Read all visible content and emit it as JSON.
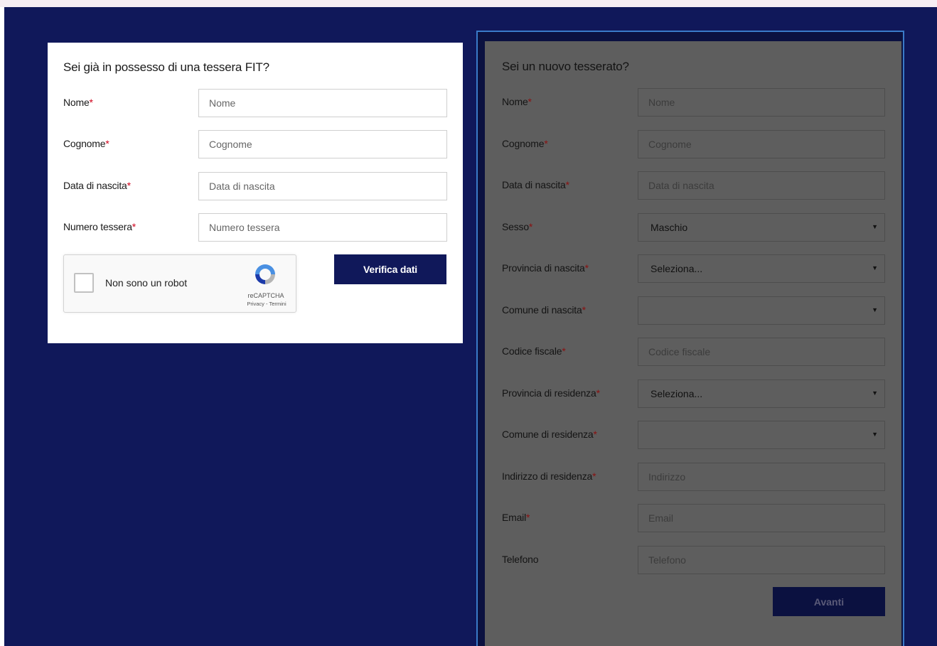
{
  "existing": {
    "title": "Sei già in possesso di una tessera FIT?",
    "required_mark": "*",
    "fields": [
      {
        "label": "Nome",
        "placeholder": "Nome"
      },
      {
        "label": "Cognome",
        "placeholder": "Cognome"
      },
      {
        "label": "Data di nascita",
        "placeholder": "Data di nascita"
      },
      {
        "label": "Numero tessera",
        "placeholder": "Numero tessera"
      }
    ],
    "captcha": {
      "text": "Non sono un robot",
      "brand": "reCAPTCHA",
      "links": "Privacy - Termini",
      "icon": "recaptcha-logo-icon"
    },
    "verify_button": "Verifica dati"
  },
  "new_member": {
    "title": "Sei un nuovo tesserato?",
    "fields": [
      {
        "label": "Nome",
        "required": "*",
        "placeholder": "Nome"
      },
      {
        "label": "Cognome",
        "required": "*",
        "placeholder": "Cognome"
      },
      {
        "label": "Data di nascita",
        "required": "*",
        "placeholder": "Data di nascita"
      },
      {
        "label": "Sesso",
        "required": "*",
        "value": "Maschio"
      },
      {
        "label": "Provincia di nascita",
        "required": "*",
        "value": "Seleziona..."
      },
      {
        "label": "Comune di nascita",
        "required": "*",
        "value": ""
      },
      {
        "label": "Codice fiscale",
        "required": "*",
        "placeholder": "Codice fiscale"
      },
      {
        "label": "Provincia di residenza",
        "required": "*",
        "value": "Seleziona..."
      },
      {
        "label": "Comune di residenza",
        "required": "*",
        "value": ""
      },
      {
        "label": "Indirizzo di residenza",
        "required": "*",
        "placeholder": "Indirizzo"
      },
      {
        "label": "Email",
        "required": "*",
        "placeholder": "Email"
      },
      {
        "label": "Telefono",
        "required": "",
        "placeholder": "Telefono"
      }
    ],
    "caret": "▼",
    "next_button": "Avanti"
  },
  "colors": {
    "background": "#10185a",
    "primary_button": "#10185a",
    "required": "#d0021b",
    "overlay": "#5e5e5e",
    "frame": "#3a7ac8"
  }
}
